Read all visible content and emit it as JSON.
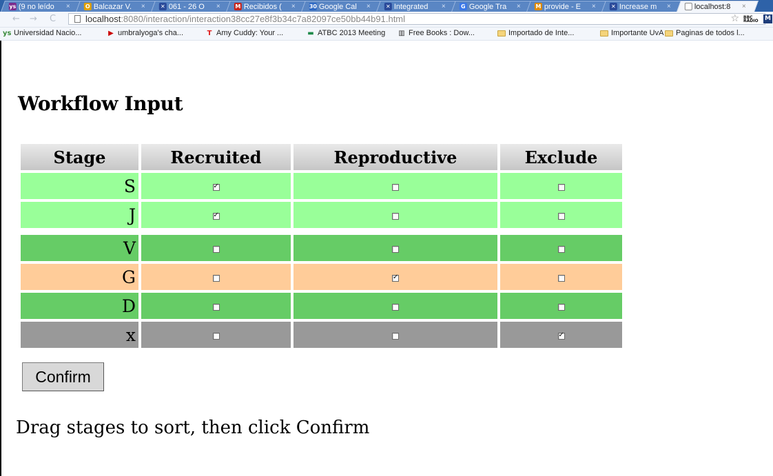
{
  "browser": {
    "tabs": [
      {
        "title": "(9 no leído",
        "icon": "ys",
        "color": "#7b2a8c"
      },
      {
        "title": "Balcazar V.",
        "icon": "O",
        "color": "#e0a000"
      },
      {
        "title": "061 - 26 O",
        "icon": "✕",
        "color": "#2a4a9a"
      },
      {
        "title": "Recibidos (",
        "icon": "M",
        "color": "#c8251c"
      },
      {
        "title": "Google Cal",
        "icon": "30",
        "color": "#2d68c4"
      },
      {
        "title": "Integrated",
        "icon": "✕",
        "color": "#2a4a9a"
      },
      {
        "title": "Google Tra",
        "icon": "G",
        "color": "#3b78e7"
      },
      {
        "title": "provide - E",
        "icon": "M",
        "color": "#e08a00"
      },
      {
        "title": "Increase m",
        "icon": "✕",
        "color": "#2a4a9a"
      },
      {
        "title": "localhost:8",
        "icon": "",
        "color": "#ffffff"
      }
    ],
    "url_host": "localhost",
    "url_rest": ":8080/interaction/interaction38cc27e8f3b34c7a82097ce50bb44b91.html",
    "bookmarks": [
      {
        "label": "Universidad Nacio...",
        "icon": "ys",
        "color": "#3a8a3a"
      },
      {
        "label": "umbralyoga's cha...",
        "icon": "▶",
        "color": "#cc0000"
      },
      {
        "label": "Amy Cuddy: Your ...",
        "icon": "T",
        "color": "#e02020"
      },
      {
        "label": "ATBC 2013 Meeting",
        "icon": "▬",
        "color": "#1f8a4a"
      },
      {
        "label": "Free Books : Dow...",
        "icon": "▥",
        "color": "#333333"
      },
      {
        "label": "Importado de Inte...",
        "icon": "folder"
      },
      {
        "label": "Importante UvA",
        "icon": "folder"
      },
      {
        "label": "Paginas de todos l...",
        "icon": "folder"
      }
    ]
  },
  "page": {
    "title": "Workflow Input",
    "table": {
      "headers": [
        "Stage",
        "Recruited",
        "Reproductive",
        "Exclude"
      ],
      "rows": [
        {
          "stage": "S",
          "recruited": true,
          "reproductive": false,
          "exclude": false,
          "color": "#99ff99"
        },
        {
          "stage": "J",
          "recruited": true,
          "reproductive": false,
          "exclude": false,
          "color": "#99ff99"
        },
        {
          "stage": "V",
          "recruited": false,
          "reproductive": false,
          "exclude": false,
          "color": "#66cc66"
        },
        {
          "stage": "G",
          "recruited": false,
          "reproductive": true,
          "exclude": false,
          "color": "#ffcc99"
        },
        {
          "stage": "D",
          "recruited": false,
          "reproductive": false,
          "exclude": false,
          "color": "#66cc66"
        },
        {
          "stage": "x",
          "recruited": false,
          "reproductive": false,
          "exclude": true,
          "color": "#999999"
        }
      ]
    },
    "confirm_label": "Confirm",
    "instructions": "Drag stages to sort, then click Confirm"
  }
}
